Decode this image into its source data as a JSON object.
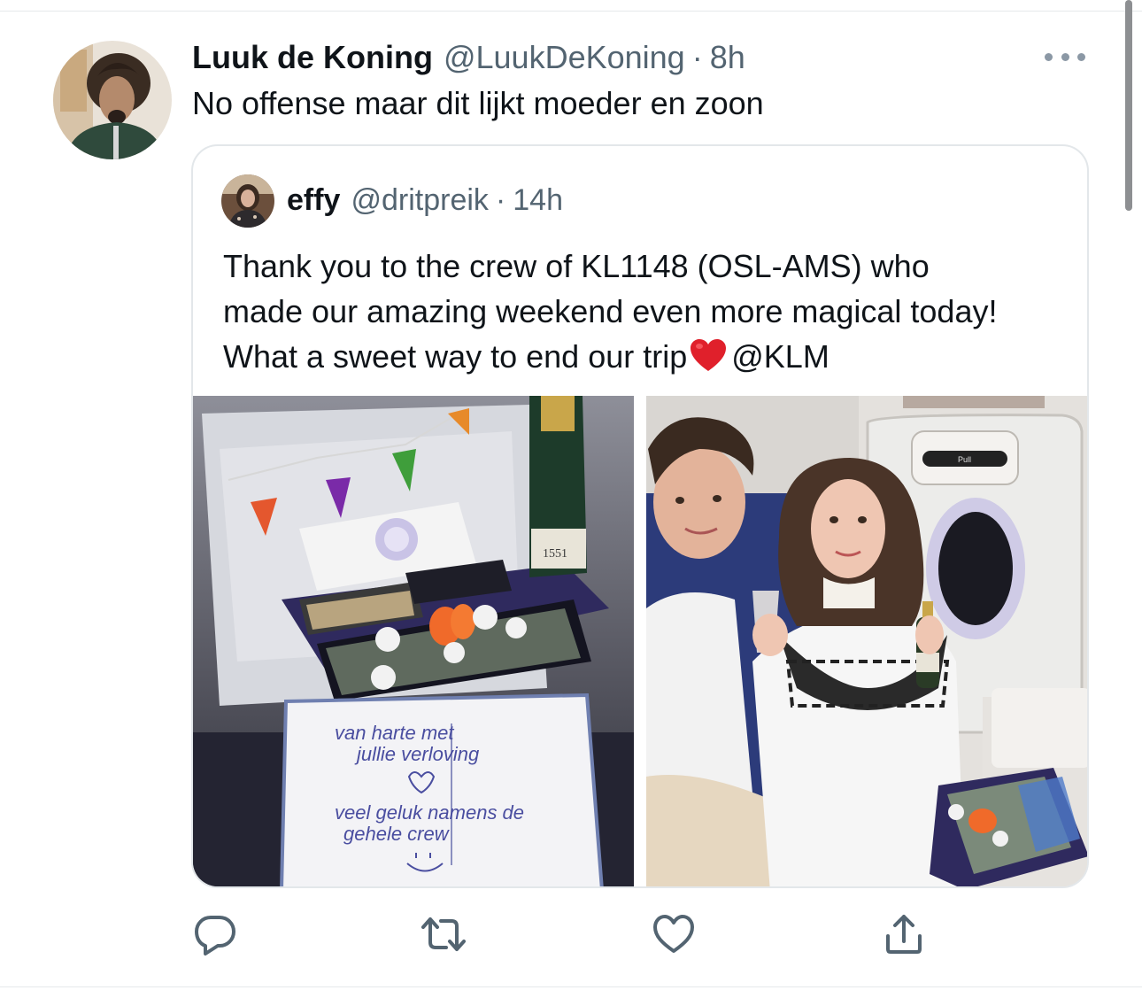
{
  "tweet": {
    "author_name": "Luuk de Koning",
    "author_handle": "@LuukDeKoning",
    "separator": "·",
    "time": "8h",
    "text": "No offense maar dit lijkt moeder en zoon"
  },
  "quoted_tweet": {
    "author_name": "effy",
    "author_handle": "@dritpreik",
    "separator": "·",
    "time": "14h",
    "text_line_1": "Thank you to the crew of KL1148 (OSL-AMS) who",
    "text_line_2": "made our amazing weekend even more magical today!",
    "text_line_3_before_emoji": "What a sweet way to end our trip",
    "text_emoji": "red-heart",
    "text_line_3_after_emoji": "@KLM",
    "media": {
      "photo_1": {
        "note_line_1": "van harte met",
        "note_line_2": "jullie verloving",
        "note_line_3": "veel geluk namens de",
        "note_line_4": "gehele crew",
        "bottle_label": "1551"
      },
      "photo_2": {
        "door_label": "Pull"
      }
    }
  },
  "actions": {
    "reply_icon": "reply-icon",
    "retweet_icon": "retweet-icon",
    "like_icon": "heart-icon",
    "share_icon": "share-icon"
  },
  "colors": {
    "text_primary": "#0f1419",
    "text_secondary": "#536471",
    "border": "#e3e7ea",
    "icon": "#536471"
  }
}
